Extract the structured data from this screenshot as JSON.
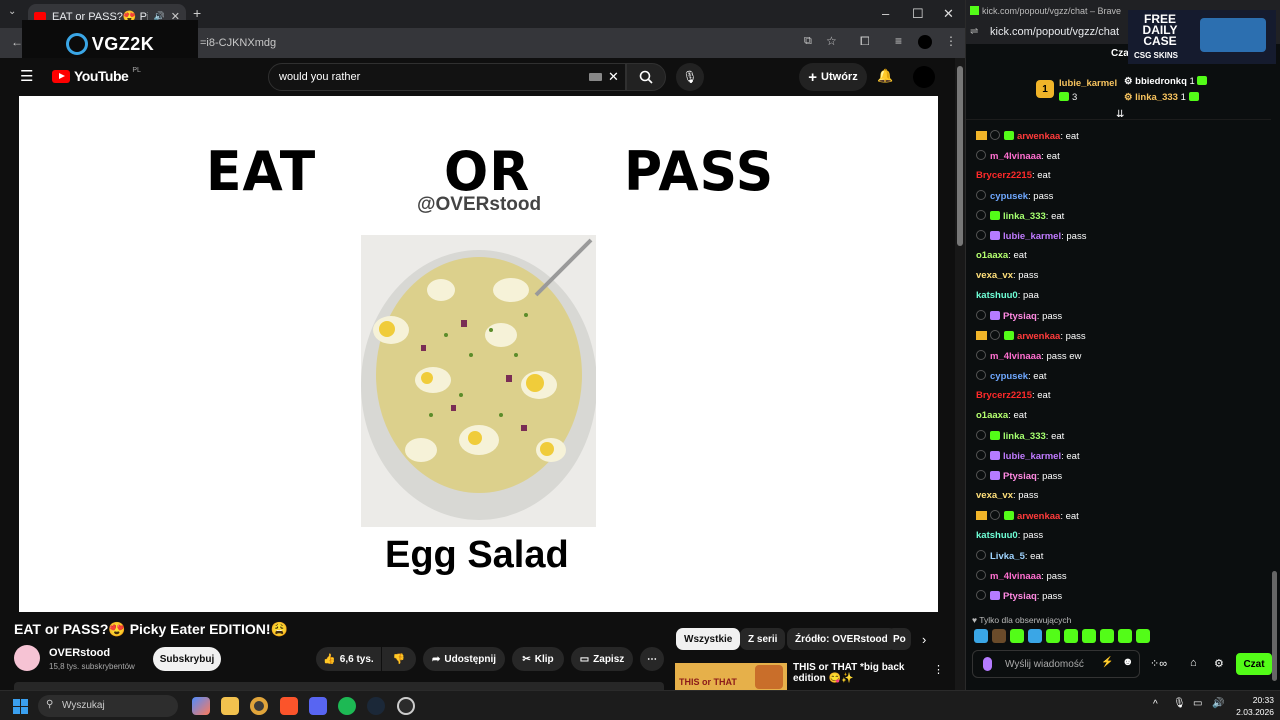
{
  "browser": {
    "tab_title": "EAT or PASS?😍 Picky Eater",
    "url_fragment": "=i8-CJKNXmdg",
    "overlay_logo": "VGZ2K"
  },
  "youtube": {
    "logo": "YouTube",
    "region": "PL",
    "search_value": "would you rather",
    "create_label": "Utwórz",
    "video": {
      "word_eat": "EAT",
      "word_or": "OR",
      "word_pass": "PASS",
      "handle": "@OVERstood",
      "food_name": "Egg Salad"
    },
    "title": "EAT or PASS?😍 Picky Eater EDITION!😩",
    "channel": {
      "name": "OVERstood",
      "subs": "15,8 tys. subskrybentów",
      "subscribe": "Subskrybuj"
    },
    "actions": {
      "likes": "6,6 tys.",
      "share": "Udostępnij",
      "clip": "Klip",
      "save": "Zapisz"
    },
    "chips": [
      "Wszystkie",
      "Z serii",
      "Źródło: OVERstood",
      "Po"
    ],
    "recommended": {
      "title": "THIS or THAT *big back edition 😋✨",
      "thumb_text": "THIS or THAT"
    }
  },
  "chat_window": {
    "title": "kick.com/popout/vgzz/chat – Brave",
    "url": "kick.com/popout/vgzz/chat",
    "header_label": "Cza",
    "ad": {
      "line": "FREE DAILY CASE",
      "brand": "CSG SKINS"
    },
    "leaderboard": [
      {
        "rank": "1",
        "name": "lubie_karmel",
        "count": "3"
      },
      {
        "rank": "",
        "name": "bbiedronkq",
        "count": "1"
      },
      {
        "rank": "",
        "name": "linka_333",
        "count": "1"
      }
    ],
    "messages": [
      {
        "badges": "crown-gift",
        "user": "arwenkaa",
        "color": "#ff3b3b",
        "text": ": eat"
      },
      {
        "badges": "plain",
        "user": "m_4lvinaaa",
        "color": "#ff6fd0",
        "text": ": eat"
      },
      {
        "badges": "none",
        "user": "Brycerz2215",
        "color": "#ff2a2a",
        "text": ": eat"
      },
      {
        "badges": "plain",
        "user": "cypusek",
        "color": "#6fa8ff",
        "text": ": pass"
      },
      {
        "badges": "gift",
        "user": "linka_333",
        "color": "#a5ff6f",
        "text": ": eat"
      },
      {
        "badges": "giftp",
        "user": "lubie_karmel",
        "color": "#c17bff",
        "text": ": pass"
      },
      {
        "badges": "none",
        "user": "o1aaxa",
        "color": "#b5ff6f",
        "text": ": eat"
      },
      {
        "badges": "none",
        "user": "vexa_vx",
        "color": "#ffe07b",
        "text": ": pass"
      },
      {
        "badges": "none",
        "user": "katshuu0",
        "color": "#6fffd7",
        "text": ": paa"
      },
      {
        "badges": "giftp",
        "user": "Ptysiaq",
        "color": "#ff8ae2",
        "text": ": pass"
      },
      {
        "badges": "crown-gift",
        "user": "arwenkaa",
        "color": "#ff3b3b",
        "text": ": pass"
      },
      {
        "badges": "plain",
        "user": "m_4lvinaaa",
        "color": "#ff6fd0",
        "text": ": pass ew"
      },
      {
        "badges": "plain",
        "user": "cypusek",
        "color": "#6fa8ff",
        "text": ": eat"
      },
      {
        "badges": "none",
        "user": "Brycerz2215",
        "color": "#ff2a2a",
        "text": ": eat"
      },
      {
        "badges": "none",
        "user": "o1aaxa",
        "color": "#b5ff6f",
        "text": ": eat"
      },
      {
        "badges": "gift",
        "user": "linka_333",
        "color": "#a5ff6f",
        "text": ": eat"
      },
      {
        "badges": "giftp",
        "user": "lubie_karmel",
        "color": "#c17bff",
        "text": ": eat"
      },
      {
        "badges": "giftp",
        "user": "Ptysiaq",
        "color": "#ff8ae2",
        "text": ": pass"
      },
      {
        "badges": "none",
        "user": "vexa_vx",
        "color": "#ffe07b",
        "text": ": pass"
      },
      {
        "badges": "crown-gift",
        "user": "arwenkaa",
        "color": "#ff3b3b",
        "text": ": eat"
      },
      {
        "badges": "none",
        "user": "katshuu0",
        "color": "#6fffd7",
        "text": ": pass"
      },
      {
        "badges": "plain",
        "user": "Livka_5",
        "color": "#9fd4ff",
        "text": ": eat"
      },
      {
        "badges": "plain",
        "user": "m_4lvinaaa",
        "color": "#ff6fd0",
        "text": ": pass"
      },
      {
        "badges": "giftp",
        "user": "Ptysiaq",
        "color": "#ff8ae2",
        "text": ": pass"
      }
    ],
    "followers_only": "Tylko dla obserwujących",
    "input_placeholder": "Wyślij wiadomość",
    "send_button": "Czat"
  },
  "taskbar": {
    "search": "Wyszukaj",
    "time": "20:33",
    "date": "2.03.2026"
  }
}
